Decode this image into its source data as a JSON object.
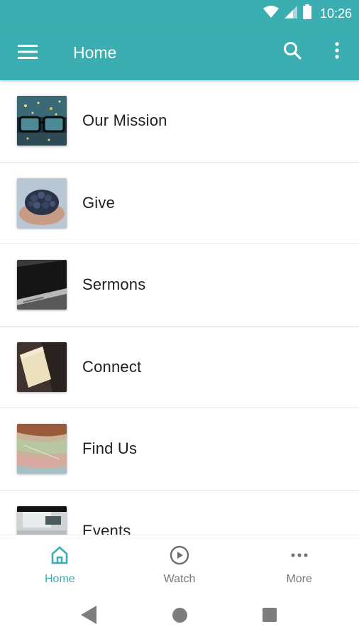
{
  "status_bar": {
    "time": "10:26",
    "icons": [
      "wifi-icon",
      "cell-signal-icon",
      "battery-icon"
    ]
  },
  "app_bar": {
    "title": "Home",
    "icons": [
      "menu-icon",
      "search-icon",
      "overflow-menu-icon"
    ]
  },
  "list": {
    "items": [
      {
        "label": "Our Mission",
        "thumbnail": "city-glasses-image"
      },
      {
        "label": "Give",
        "thumbnail": "hands-blueberries-image"
      },
      {
        "label": "Sermons",
        "thumbnail": "phone-closeup-image"
      },
      {
        "label": "Connect",
        "thumbnail": "notecard-table-image"
      },
      {
        "label": "Find Us",
        "thumbnail": "map-image"
      },
      {
        "label": "Events",
        "thumbnail": "desk-items-image"
      }
    ]
  },
  "bottom_nav": {
    "items": [
      {
        "label": "Home",
        "icon": "home-icon",
        "active": true
      },
      {
        "label": "Watch",
        "icon": "play-circle-icon",
        "active": false
      },
      {
        "label": "More",
        "icon": "more-horizontal-icon",
        "active": false
      }
    ]
  },
  "colors": {
    "primary": "#3aaeb0",
    "text": "#1f1f1f",
    "inactive": "#777777"
  }
}
